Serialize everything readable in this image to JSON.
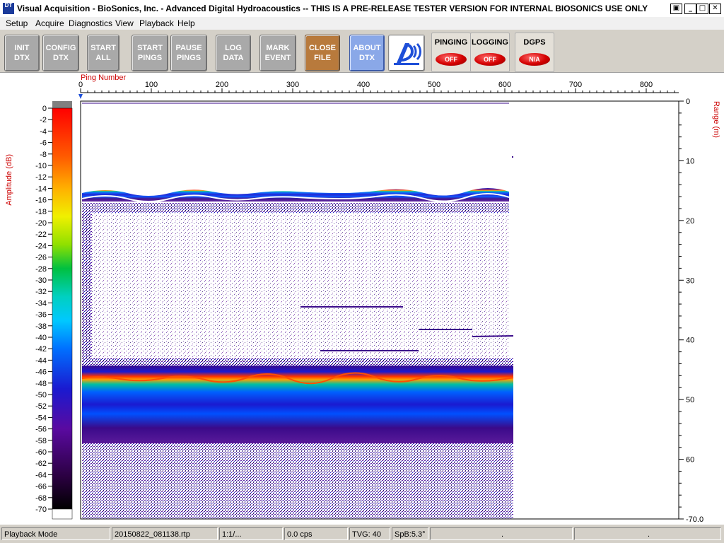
{
  "window": {
    "icon_label": "DT",
    "title": "Visual Acquisition  -  BioSonics, Inc.  -  Advanced Digital Hydroacoustics  -- THIS IS A PRE-RELEASE TESTER VERSION FOR INTERNAL BIOSONICS USE ONLY",
    "restore_glyph": "▣",
    "minimize_glyph": "_",
    "maximize_glyph": "□",
    "close_glyph": "✕"
  },
  "menu": [
    "Setup",
    "Acquire",
    "Diagnostics",
    "View",
    "Playback",
    "Help"
  ],
  "toolbar": {
    "buttons": [
      {
        "label": "INIT\nDTX",
        "style": "gray"
      },
      {
        "label": "CONFIG\nDTX",
        "style": "gray"
      },
      {
        "label": "START\nALL",
        "style": "gray"
      },
      {
        "label": "START\nPINGS",
        "style": "gray"
      },
      {
        "label": "PAUSE\nPINGS",
        "style": "gray"
      },
      {
        "label": "LOG\nDATA",
        "style": "gray"
      },
      {
        "label": "MARK\nEVENT",
        "style": "gray"
      },
      {
        "label": "CLOSE\nFILE",
        "style": "orange"
      },
      {
        "label": "ABOUT\nDTX",
        "style": "blue"
      }
    ],
    "indicators": [
      {
        "title": "PINGING",
        "state": "OFF"
      },
      {
        "title": "LOGGING",
        "state": "OFF"
      },
      {
        "title": "DGPS",
        "state": "N/A"
      }
    ]
  },
  "echogram": {
    "x_axis_label": "Ping Number",
    "y_axis_label": "Range (m)",
    "x_ticks": [
      0,
      100,
      200,
      300,
      400,
      500,
      600,
      700,
      800
    ],
    "range_ticks": [
      "0",
      "10",
      "20",
      "30",
      "40",
      "50",
      "60",
      "-70.0"
    ],
    "amplitude_label": "Amplitude (dB)",
    "amplitude_ticks": [
      "0",
      "-2",
      "-4",
      "-6",
      "-8",
      "-10",
      "-12",
      "-14",
      "-16",
      "-18",
      "-20",
      "-22",
      "-24",
      "-26",
      "-28",
      "-30",
      "-32",
      "-34",
      "-36",
      "-38",
      "-40",
      "-42",
      "-44",
      "-46",
      "-48",
      "-50",
      "-52",
      "-54",
      "-56",
      "-58",
      "-60",
      "-62",
      "-64",
      "-66",
      "-68",
      "-70"
    ],
    "colors": {
      "axis_label": "#cc0000",
      "surface_band": "#3a0a8a",
      "bottom_peak": "#ff3300",
      "bottom_core": "#0050ff",
      "bottom_tail": "#1a1ad0"
    }
  },
  "status": {
    "mode": "Playback Mode",
    "file": "20150822_081138.rtp",
    "ratio": "1:1/...",
    "rate": "0.0 cps",
    "tvg": "TVG: 40",
    "spb": "SpB:5.3°",
    "extra1": ".",
    "extra2": "."
  }
}
